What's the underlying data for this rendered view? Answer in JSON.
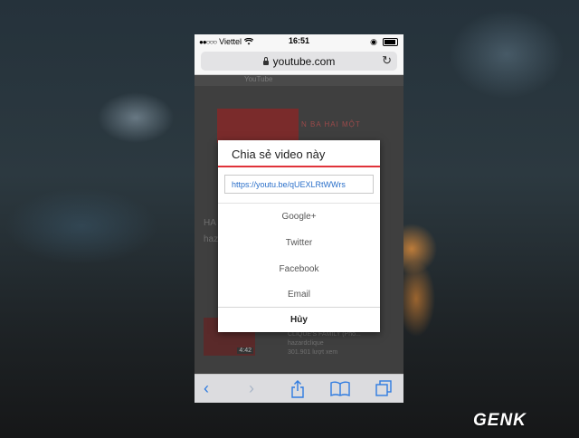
{
  "status_bar": {
    "carrier": "Viettel",
    "time": "16:51"
  },
  "address_bar": {
    "url": "youtube.com"
  },
  "background_page": {
    "header_label": "YouTube",
    "banner_text": "N BA HAI MỘT",
    "video_title_partial": "HA M",
    "video_channel_partial": "haz",
    "related_title": "CLIQUE'S FAMILY (Phố...",
    "related_channel": "hazardclique",
    "related_views": "301.901 lượt xem",
    "thumb_duration": "4:42"
  },
  "share_dialog": {
    "title": "Chia sẻ video này",
    "link": "https://youtu.be/qUEXLRtWWrs",
    "options": [
      "Google+",
      "Twitter",
      "Facebook",
      "Email"
    ],
    "cancel_label": "Hủy",
    "accent_color": "#e0333a"
  },
  "toolbar": {
    "icons": [
      "back-icon",
      "forward-icon",
      "share-icon",
      "bookmarks-icon",
      "tabs-icon"
    ]
  },
  "watermark": {
    "text": "GENK"
  }
}
